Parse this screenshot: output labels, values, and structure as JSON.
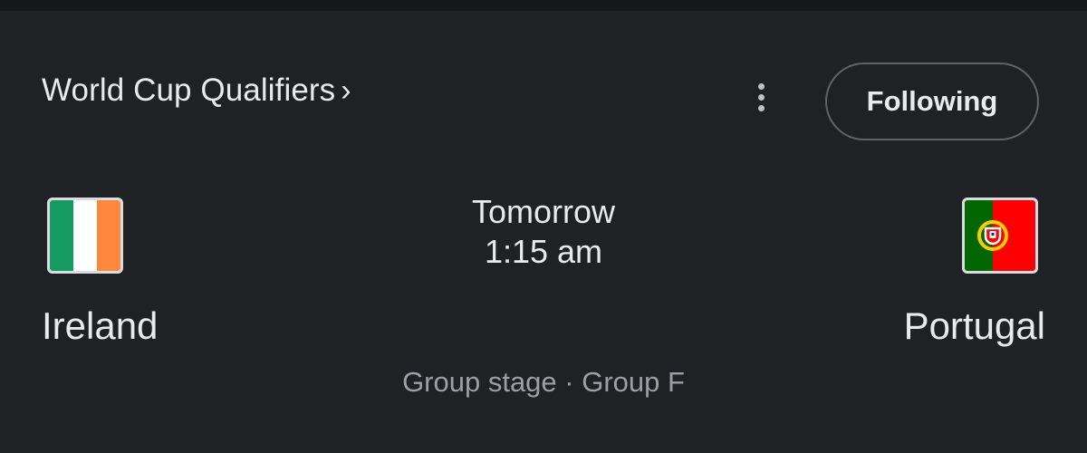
{
  "header": {
    "competition": "World Cup Qualifiers",
    "chevron_icon": "chevron-right-icon",
    "more_icon": "more-vert-icon",
    "follow_label": "Following"
  },
  "match": {
    "home": {
      "name": "Ireland",
      "flag_icon": "ireland-flag-icon",
      "flag_colors": [
        "#169B62",
        "#FFFFFF",
        "#FF883E"
      ]
    },
    "away": {
      "name": "Portugal",
      "flag_icon": "portugal-flag-icon",
      "flag_colors": [
        "#006600",
        "#FF0000",
        "#FFCC00"
      ]
    },
    "day": "Tomorrow",
    "time": "1:15 am",
    "stage": "Group stage · Group F"
  },
  "colors": {
    "background": "#202124",
    "text_primary": "#e8eaed",
    "text_secondary": "#9aa0a6",
    "button_border": "#5f6368"
  }
}
